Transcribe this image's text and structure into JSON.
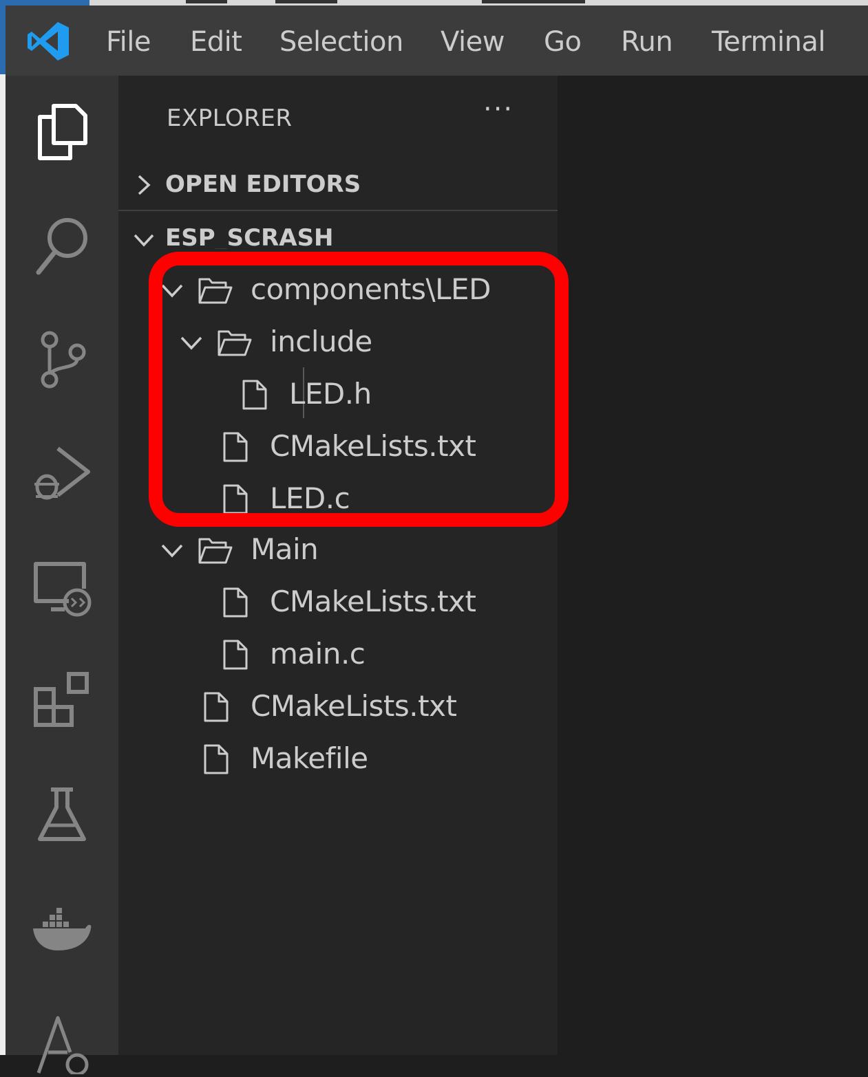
{
  "menu": {
    "items": [
      "File",
      "Edit",
      "Selection",
      "View",
      "Go",
      "Run",
      "Terminal"
    ]
  },
  "activity_bar": {
    "icons": [
      "explorer-icon",
      "search-icon",
      "source-control-icon",
      "run-debug-icon",
      "remote-explorer-icon",
      "extensions-icon",
      "testing-icon",
      "docker-icon",
      "esp-idf-icon"
    ]
  },
  "sidebar": {
    "title": "EXPLORER",
    "more_actions": "···",
    "open_editors": "OPEN EDITORS",
    "workspace": "ESP_SCRASH",
    "tree": [
      {
        "name": "components\\LED",
        "type": "folder",
        "expanded": true
      },
      {
        "name": "include",
        "type": "folder",
        "expanded": true
      },
      {
        "name": "LED.h",
        "type": "file"
      },
      {
        "name": "CMakeLists.txt",
        "type": "file"
      },
      {
        "name": "LED.c",
        "type": "file"
      },
      {
        "name": "Main",
        "type": "folder",
        "expanded": true
      },
      {
        "name": "CMakeLists.txt",
        "type": "file"
      },
      {
        "name": "main.c",
        "type": "file"
      },
      {
        "name": "CMakeLists.txt",
        "type": "file"
      },
      {
        "name": "Makefile",
        "type": "file"
      }
    ]
  },
  "colors": {
    "titlebar": "#3c3c3c",
    "activitybar": "#333333",
    "sidebar": "#252526",
    "editor": "#1e1e1e",
    "highlight": "#ff0000",
    "vscode_blue": "#23a9f2"
  }
}
